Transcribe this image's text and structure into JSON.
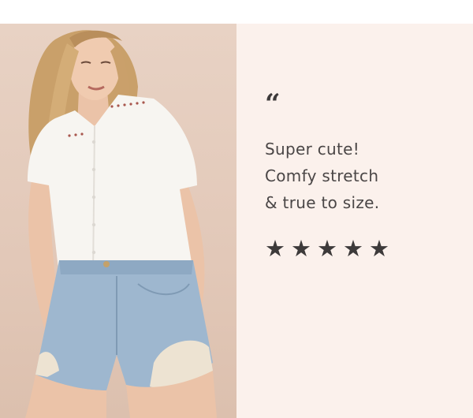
{
  "testimonial": {
    "quote_mark": "“",
    "lines": [
      "Super cute!",
      "Comfy stretch",
      "& true to size."
    ],
    "rating": 5,
    "rating_max": 5,
    "star_glyph": "★"
  },
  "colors": {
    "panel_bg": "#fbf1ec",
    "photo_bg": "#e4cbbb",
    "text": "#4a4646",
    "star": "#3d3a3a"
  },
  "photo": {
    "icon": "model-photo"
  }
}
